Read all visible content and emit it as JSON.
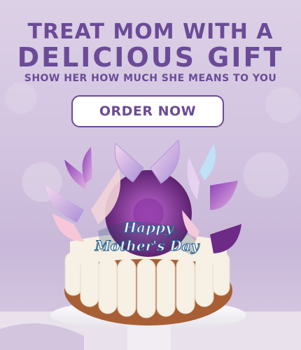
{
  "banner": {
    "headline_line1": "TREAT MOM WITH A",
    "headline_line2": "DELICIOUS GIFT",
    "subheadline": "SHOW HER HOW MUCH SHE MEANS TO YOU",
    "cta_label": "ORDER NOW",
    "topper_text_1": "Happy",
    "topper_text_2": "Mother's Day"
  },
  "colors": {
    "accent": "#6b4b97",
    "background": "#d2c3e0",
    "frosting": "#f6efe4",
    "cake": "#b06a3e",
    "flower": "#7a2f8e"
  }
}
